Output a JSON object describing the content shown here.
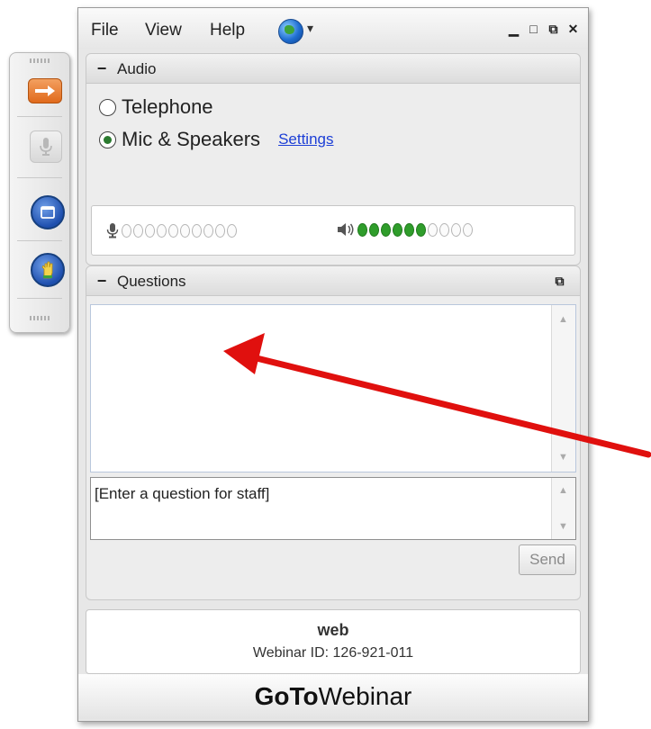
{
  "menubar": {
    "file": "File",
    "view": "View",
    "help": "Help",
    "globe_caret": "▾",
    "minimize": "▁",
    "maximize": "□",
    "restore": "⧉",
    "close": "✕"
  },
  "audio": {
    "title": "Audio",
    "collapse": "−",
    "option_telephone": "Telephone",
    "option_mic": "Mic & Speakers",
    "selected": "Mic & Speakers",
    "settings_link": "Settings",
    "mic_level": 0,
    "speaker_level": 0.6
  },
  "questions": {
    "title": "Questions",
    "collapse": "−",
    "popout": "⧉",
    "input_placeholder": "[Enter a question for staff]",
    "send_label": "Send"
  },
  "info": {
    "name": "web",
    "webinar_id": "Webinar ID: 126-921-011"
  },
  "brand": {
    "goto": "GoTo",
    "webinar": "Webinar"
  },
  "colors": {
    "accent_orange": "#e06a1c",
    "link_blue": "#1d3fd6",
    "meter_green": "#2f9d2b",
    "annotation_red": "#e0100e"
  }
}
